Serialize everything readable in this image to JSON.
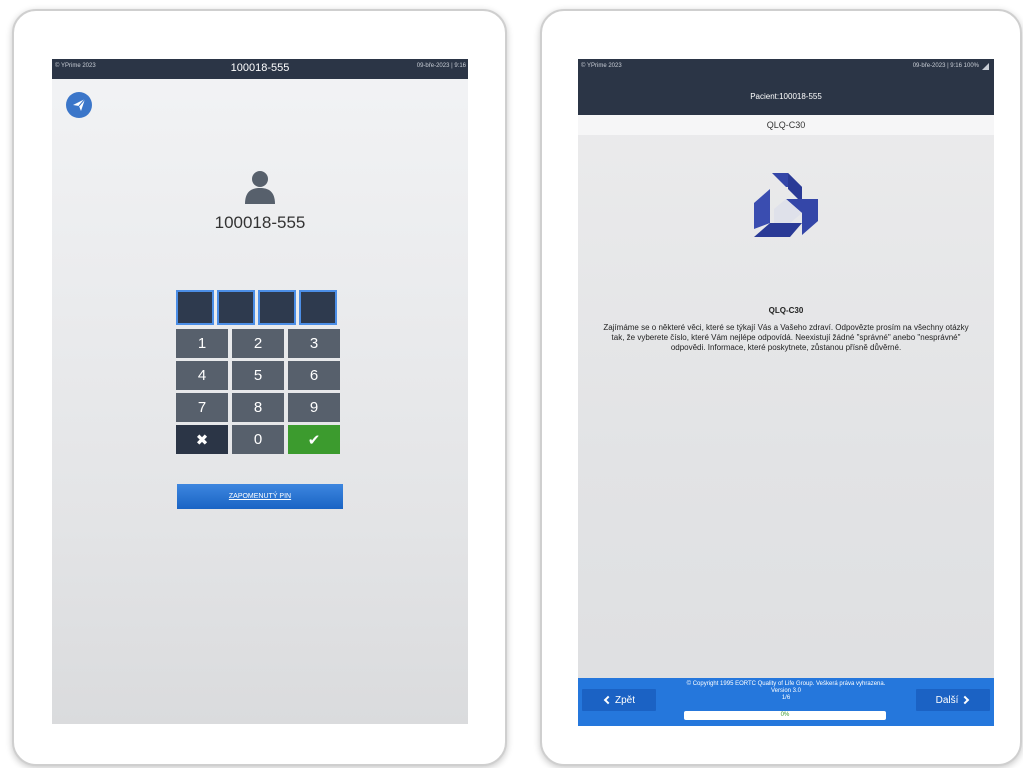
{
  "left_screen": {
    "status_bar": {
      "left_text": "© YPrime 2023",
      "center_text": "100018-555",
      "right_text": "09-bře-2023 | 9:16"
    },
    "user_id": "100018-555",
    "pin_length": 4,
    "keypad": {
      "keys": [
        "1",
        "2",
        "3",
        "4",
        "5",
        "6",
        "7",
        "8",
        "9"
      ],
      "zero": "0",
      "clear_symbol": "✖",
      "ok_symbol": "✔"
    },
    "forgot_pin_label": "ZAPOMENUTÝ PIN"
  },
  "right_screen": {
    "status_bar": {
      "left_text": "© YPrime 2023",
      "right_text": "09-bře-2023 | 9:16 100%"
    },
    "patient_label": "Pacient:100018-555",
    "questionnaire_name": "QLQ-C30",
    "content_title": "QLQ-C30",
    "content_text": "Zajímáme se o některé věci, které se týkají Vás a Vašeho zdraví. Odpovězte prosím na všechny otázky tak, že vyberete číslo, které Vám nejlépe odpovídá. Neexistují žádné \"správné\" anebo \"nesprávné\" odpovědi. Informace, které poskytnete, zůstanou přísně důvěrné.",
    "footer": {
      "back_label": "Zpět",
      "next_label": "Další",
      "copyright": "© Copyright 1995 EORTC Quality of Life Group. Veškerá práva vyhrazena. Version 3.0",
      "page_indicator": "1/6",
      "progress_text": "0%",
      "progress_fraction": 0
    }
  },
  "colors": {
    "header_dark": "#2b3546",
    "accent_blue": "#2577dc",
    "success_green": "#3c9b2e",
    "key_gray": "#57606c",
    "logo_blue": "#3446a8"
  },
  "icons": [
    "send-icon",
    "person-icon",
    "close-icon",
    "checkmark-icon",
    "questionnaire-logo",
    "signal-icon",
    "chevron-left-icon",
    "chevron-right-icon"
  ]
}
